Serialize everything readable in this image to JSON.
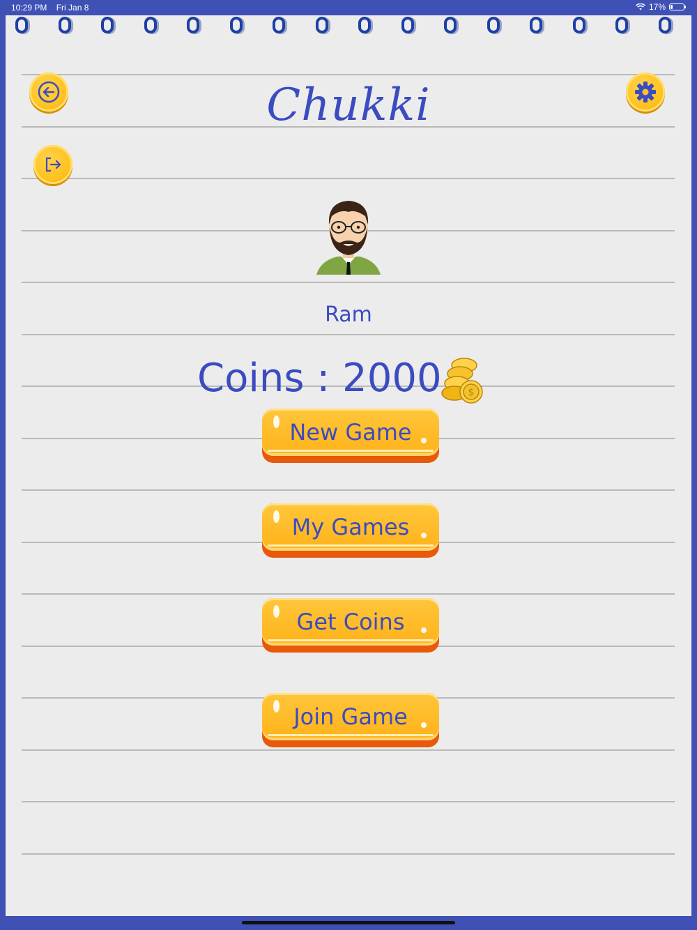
{
  "status_bar": {
    "time": "10:29 PM",
    "date": "Fri Jan 8",
    "battery": "17%",
    "battery_level": 0.17
  },
  "header": {
    "title": "Chukki",
    "back_icon": "arrow-left-icon",
    "settings_icon": "gear-icon",
    "logout_icon": "logout-icon"
  },
  "profile": {
    "name": "Ram",
    "avatar_icon": "bearded-man-avatar"
  },
  "coins": {
    "label": "Coins : 2000",
    "icon": "coin-stack-icon"
  },
  "menu": {
    "new_game": "New Game",
    "my_games": "My Games",
    "get_coins": "Get Coins",
    "join_game": "Join Game"
  },
  "colors": {
    "accent": "#3b4cc0",
    "frame": "#3f51b5",
    "button": "#ffb21a",
    "paper": "#ececec"
  }
}
